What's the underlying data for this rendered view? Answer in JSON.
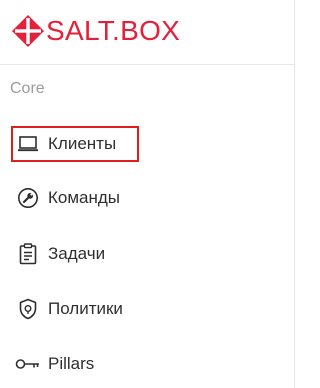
{
  "brand": {
    "name": "SALT.BOX",
    "color": "#e5203a"
  },
  "sidebar": {
    "section_label": "Core",
    "items": [
      {
        "label": "Клиенты",
        "icon": "laptop-icon",
        "active": true
      },
      {
        "label": "Команды",
        "icon": "wrench-icon",
        "active": false
      },
      {
        "label": "Задачи",
        "icon": "clipboard-icon",
        "active": false
      },
      {
        "label": "Политики",
        "icon": "shield-icon",
        "active": false
      },
      {
        "label": "Pillars",
        "icon": "key-icon",
        "active": false
      }
    ]
  },
  "colors": {
    "active_outline": "#e01e1e",
    "section_label": "#9b9b9b",
    "item_text": "#2f2f2f"
  }
}
